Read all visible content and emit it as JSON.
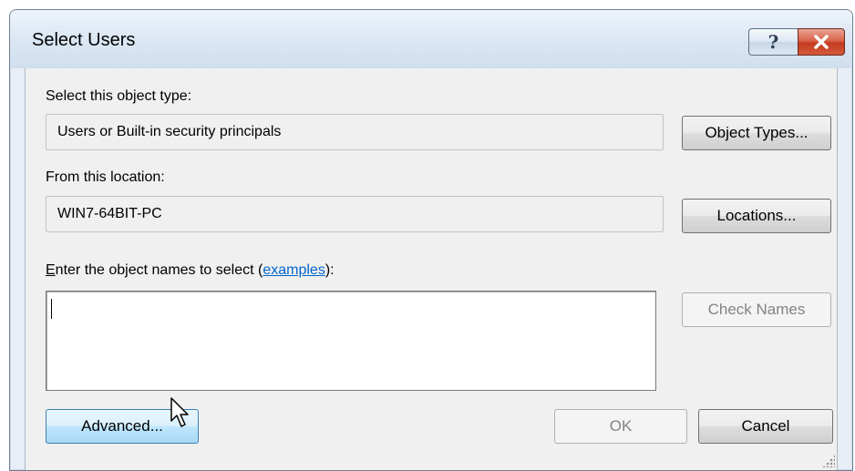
{
  "window": {
    "title": "Select Users",
    "help_glyph": "?",
    "help_icon": "question-mark-icon",
    "close_icon": "close-x-icon"
  },
  "object_type": {
    "label": "Select this object type:",
    "value": "Users or Built-in security principals",
    "button": "Object Types..."
  },
  "location": {
    "label": "From this location:",
    "value": "WIN7-64BIT-PC",
    "button": "Locations..."
  },
  "names": {
    "label_accel": "E",
    "label_rest": "nter the object names to select (",
    "link": "examples",
    "label_end": "):",
    "value": "",
    "check_button": "Check Names"
  },
  "footer": {
    "advanced_button": "Advanced...",
    "ok_button": "OK",
    "cancel_button": "Cancel"
  },
  "colors": {
    "link": "#0066cc",
    "close_button": "#c23a20",
    "hover_button": "#3c7fb1"
  }
}
